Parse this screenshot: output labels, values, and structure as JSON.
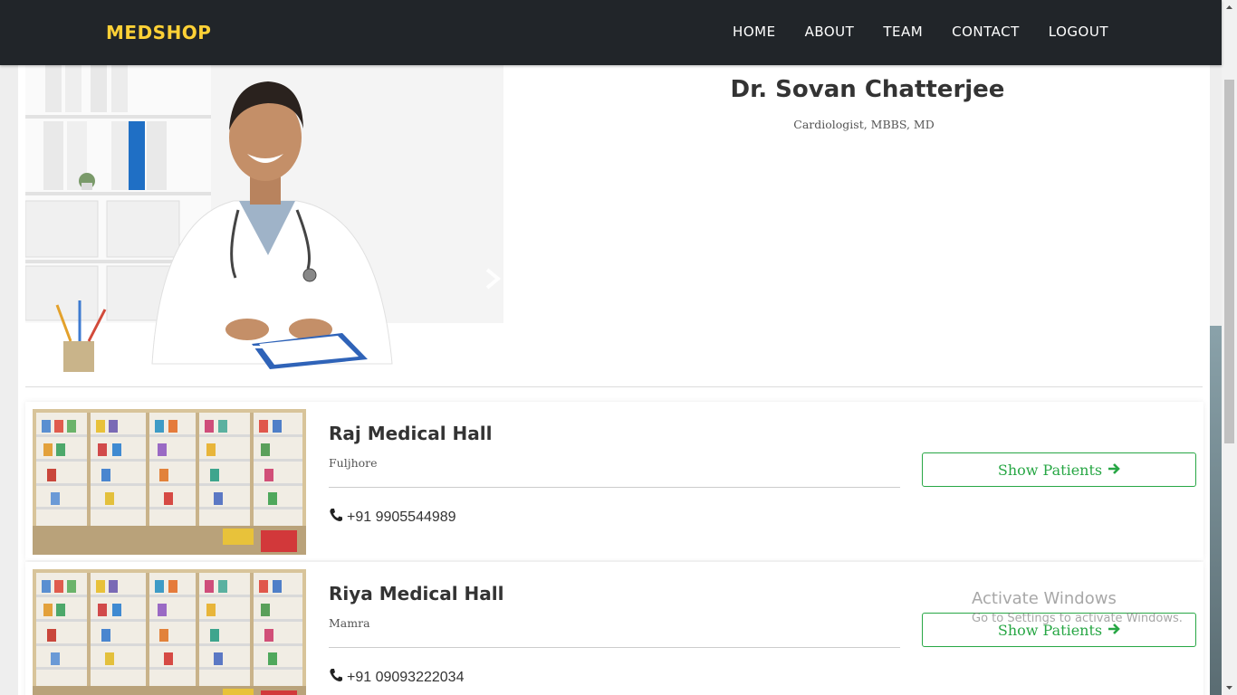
{
  "navbar": {
    "brand": "MEDSHOP",
    "links": [
      "HOME",
      "ABOUT",
      "TEAM",
      "CONTACT",
      "LOGOUT"
    ]
  },
  "doctor": {
    "name": "Dr. Sovan Chatterjee",
    "qualification": "Cardiologist, MBBS, MD",
    "carousel": {
      "slide_count": 3,
      "active_slide": 2
    }
  },
  "shops": [
    {
      "name": "Raj Medical Hall",
      "place": "Fuljhore",
      "phone": "+91 9905544989",
      "button_label": "Show Patients"
    },
    {
      "name": "Riya Medical Hall",
      "place": "Mamra",
      "phone": "+91 09093222034",
      "button_label": "Show Patients"
    }
  ],
  "watermark": {
    "title": "Activate Windows",
    "subtitle": "Go to Settings to activate Windows."
  },
  "colors": {
    "navbar_bg": "#212529",
    "brand": "#fed136",
    "success": "#28a745"
  }
}
